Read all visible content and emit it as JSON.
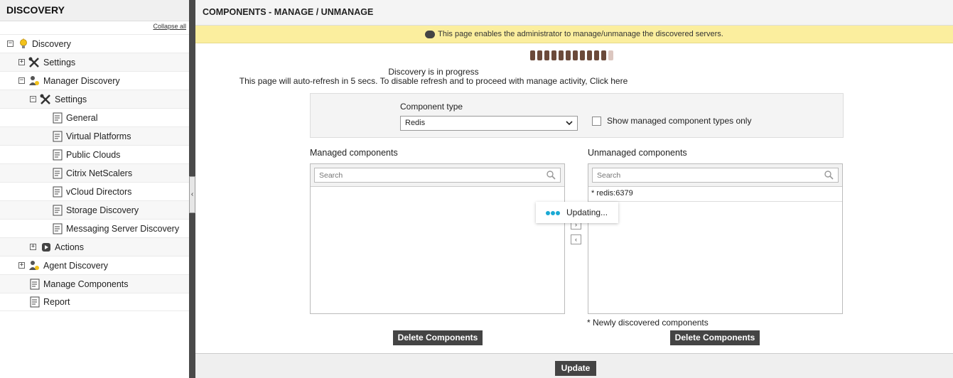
{
  "sidebar": {
    "title": "DISCOVERY",
    "collapse_all": "Collapse all",
    "items": [
      {
        "label": "Discovery",
        "expander": "−",
        "icon": "lightbulb-icon"
      },
      {
        "label": "Settings",
        "expander": "+",
        "icon": "tools-icon"
      },
      {
        "label": "Manager Discovery",
        "expander": "−",
        "icon": "manager-icon"
      },
      {
        "label": "Settings",
        "expander": "−",
        "icon": "tools-icon"
      },
      {
        "label": "General",
        "icon": "page-icon"
      },
      {
        "label": "Virtual Platforms",
        "icon": "page-icon"
      },
      {
        "label": "Public Clouds",
        "icon": "page-icon"
      },
      {
        "label": "Citrix NetScalers",
        "icon": "page-icon"
      },
      {
        "label": "vCloud Directors",
        "icon": "page-icon"
      },
      {
        "label": "Storage Discovery",
        "icon": "page-icon"
      },
      {
        "label": "Messaging Server Discovery",
        "icon": "page-icon"
      },
      {
        "label": "Actions",
        "expander": "+",
        "icon": "actions-icon"
      },
      {
        "label": "Agent Discovery",
        "expander": "+",
        "icon": "agent-icon"
      },
      {
        "label": "Manage Components",
        "icon": "page-icon"
      },
      {
        "label": "Report",
        "icon": "page-icon"
      }
    ]
  },
  "main": {
    "title": "COMPONENTS - MANAGE / UNMANAGE",
    "info": "This page enables the administrator to manage/unmanage the discovered servers.",
    "progress": {
      "total_segments": 12,
      "filled_segments": 11
    },
    "discovery_status": "Discovery is in progress",
    "refresh_text": "This page will auto-refresh in 5 secs. To disable refresh and to proceed with manage activity,",
    "click_here": "Click here",
    "component_type_label": "Component type",
    "component_type_value": "Redis",
    "show_managed_label": "Show managed component types only",
    "managed": {
      "title": "Managed components",
      "search_placeholder": "Search",
      "items": []
    },
    "unmanaged": {
      "title": "Unmanaged components",
      "search_placeholder": "Search",
      "items": [
        "* redis:6379"
      ]
    },
    "updating": "Updating...",
    "new_note": "* Newly discovered components",
    "delete_label": "Delete Components",
    "update_label": "Update"
  },
  "colors": {
    "info_bar": "#fbee9e",
    "button_dark": "#444444",
    "progress_filled": "#6b4a3a",
    "progress_empty": "#dcc7c0",
    "spinner": "#1aa9d4"
  }
}
